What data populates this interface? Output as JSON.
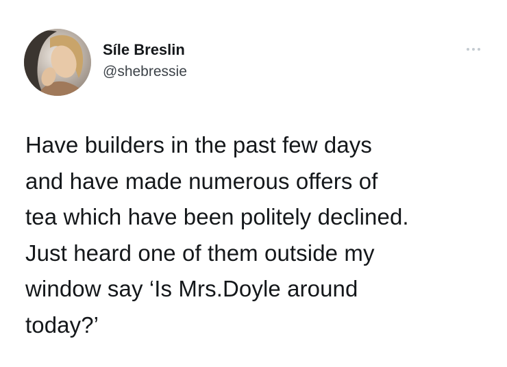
{
  "author": {
    "display_name": "Síle Breslin",
    "handle": "@shebressie",
    "avatar_icon": "profile-photo"
  },
  "menu": {
    "icon": "more-options-icon"
  },
  "tweet": {
    "lines": [
      "Have builders in the past few days",
      "and have made numerous offers of",
      "tea which have been politely declined.",
      "Just heard one of them outside my",
      "window say ‘Is Mrs.Doyle around",
      "today?’"
    ]
  },
  "colors": {
    "text": "#14171a",
    "secondary_text": "#3c4248",
    "background": "#ffffff",
    "menu_dots": "#c4cbd1"
  }
}
